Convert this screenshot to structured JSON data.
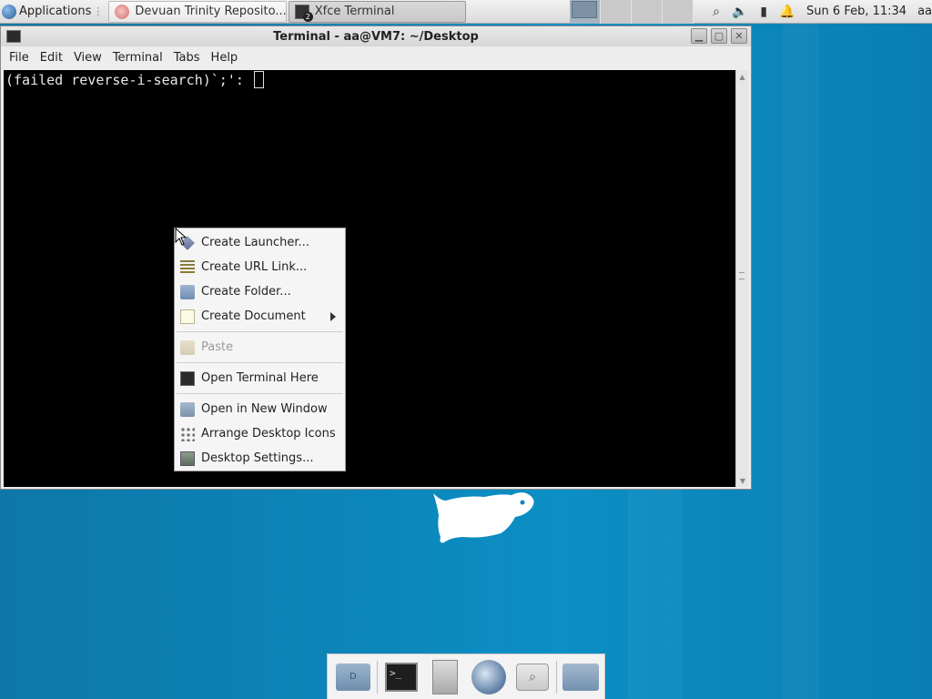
{
  "top_panel": {
    "app_menu_label": "Applications",
    "tasks": [
      {
        "label": "Devuan Trinity Reposito...",
        "icon": "browser-icon"
      },
      {
        "label": "Xfce Terminal",
        "icon": "terminal-icon",
        "badge": "2"
      }
    ],
    "clock": "Sun  6 Feb, 11:34",
    "user": "aa"
  },
  "window": {
    "title": "Terminal - aa@VM7: ~/Desktop",
    "menu": [
      "File",
      "Edit",
      "View",
      "Terminal",
      "Tabs",
      "Help"
    ],
    "terminal_line": "(failed reverse-i-search)`;': "
  },
  "context_menu": {
    "items": [
      {
        "label": "Create Launcher...",
        "icon": "launcher-icon"
      },
      {
        "label": "Create URL Link...",
        "icon": "url-link-icon"
      },
      {
        "label": "Create Folder...",
        "icon": "folder-icon"
      },
      {
        "label": "Create Document",
        "icon": "document-icon"
      },
      {
        "label": "Paste",
        "icon": "paste-icon"
      },
      {
        "label": "Open Terminal Here",
        "icon": "terminal-icon"
      },
      {
        "label": "Open in New Window",
        "icon": "window-icon"
      },
      {
        "label": "Arrange Desktop Icons",
        "icon": "arrange-icon"
      },
      {
        "label": "Desktop Settings...",
        "icon": "settings-icon"
      }
    ]
  }
}
